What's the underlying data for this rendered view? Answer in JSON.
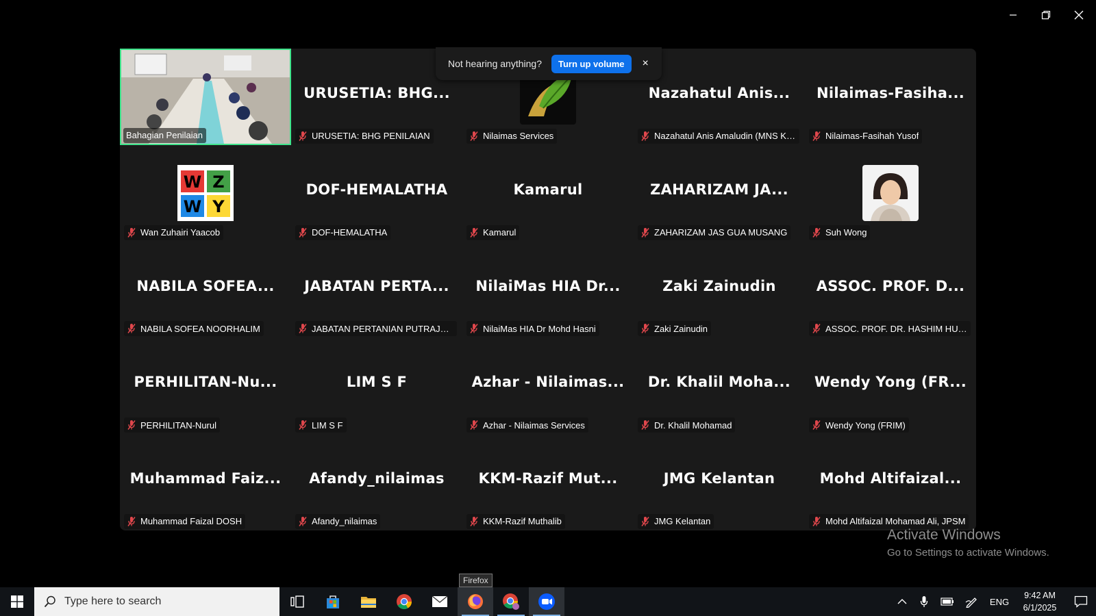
{
  "gallery": {
    "participants": [
      {
        "display_name": "",
        "name": "Bahagian Penilaian",
        "type": "video"
      },
      {
        "display_name": "URUSETIA: BHG...",
        "name": "URUSETIA: BHG PENILAIAN",
        "type": "text"
      },
      {
        "display_name": "",
        "name": "Nilaimas Services",
        "type": "logo"
      },
      {
        "display_name": "Nazahatul Anis...",
        "name": "Nazahatul Anis Amaludin (MNS Kela...",
        "type": "text"
      },
      {
        "display_name": "Nilaimas-Fasiha...",
        "name": "Nilaimas-Fasihah Yusof",
        "type": "text"
      },
      {
        "display_name": "",
        "name": "Wan Zuhairi Yaacob",
        "type": "wzwy"
      },
      {
        "display_name": "DOF-HEMALATHA",
        "name": "DOF-HEMALATHA",
        "type": "text"
      },
      {
        "display_name": "Kamarul",
        "name": "Kamarul",
        "type": "text"
      },
      {
        "display_name": "ZAHARIZAM JA...",
        "name": "ZAHARIZAM JAS GUA MUSANG",
        "type": "text"
      },
      {
        "display_name": "",
        "name": "Suh Wong",
        "type": "photo"
      },
      {
        "display_name": "NABILA SOFEA...",
        "name": "NABILA SOFEA NOORHALIM",
        "type": "text"
      },
      {
        "display_name": "JABATAN PERTA...",
        "name": "JABATAN PERTANIAN PUTRAJAYA",
        "type": "text"
      },
      {
        "display_name": "NilaiMas HIA Dr...",
        "name": "NilaiMas HIA Dr Mohd Hasni",
        "type": "text"
      },
      {
        "display_name": "Zaki Zainudin",
        "name": "Zaki Zainudin",
        "type": "text"
      },
      {
        "display_name": "ASSOC. PROF. D...",
        "name": "ASSOC. PROF. DR. HASHIM HUSSIN (...",
        "type": "text"
      },
      {
        "display_name": "PERHILITAN-Nu...",
        "name": "PERHILITAN-Nurul",
        "type": "text"
      },
      {
        "display_name": "LIM S F",
        "name": "LIM S F",
        "type": "text"
      },
      {
        "display_name": "Azhar - Nilaimas...",
        "name": "Azhar - Nilaimas Services",
        "type": "text"
      },
      {
        "display_name": "Dr. Khalil Moha...",
        "name": "Dr. Khalil Mohamad",
        "type": "text"
      },
      {
        "display_name": "Wendy Yong (FR...",
        "name": "Wendy Yong (FRIM)",
        "type": "text"
      },
      {
        "display_name": "Muhammad Faiz...",
        "name": "Muhammad Faizal DOSH",
        "type": "text"
      },
      {
        "display_name": "Afandy_nilaimas",
        "name": "Afandy_nilaimas",
        "type": "text"
      },
      {
        "display_name": "KKM-Razif Mut...",
        "name": "KKM-Razif Muthalib",
        "type": "text"
      },
      {
        "display_name": "JMG Kelantan",
        "name": "JMG Kelantan",
        "type": "text"
      },
      {
        "display_name": "Mohd Altifaizal...",
        "name": "Mohd Altifaizal Mohamad Ali, JPSM",
        "type": "text"
      }
    ],
    "muted_icon": "muted-mic-icon",
    "active_speaker_color": "#3fe48b"
  },
  "notification": {
    "message": "Not hearing anything?",
    "button": "Turn up volume",
    "close": "×"
  },
  "watermark": {
    "line1": "Activate Windows",
    "line2": "Go to Settings to activate Windows."
  },
  "tooltip": "Firefox",
  "taskbar": {
    "search_placeholder": "Type here to search",
    "apps": [
      "task-view-icon",
      "microsoft-store-icon",
      "file-explorer-icon",
      "chrome-icon",
      "mail-icon",
      "firefox-icon",
      "chrome-profile-icon",
      "zoom-icon"
    ],
    "language": "ENG",
    "time": "9:42 AM",
    "date": "6/1/2025"
  },
  "colors": {
    "accent_blue": "#0e71eb",
    "muted_red": "#e0474c"
  }
}
